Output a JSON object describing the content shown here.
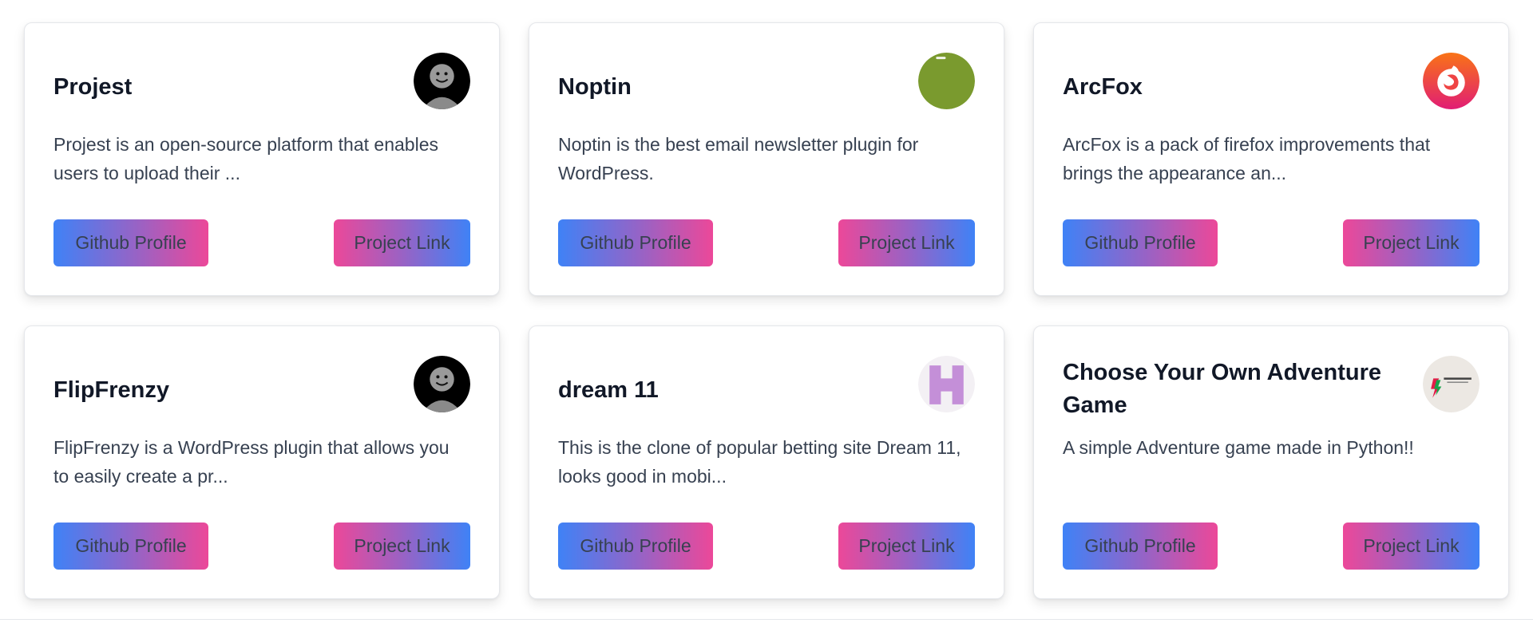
{
  "buttons": {
    "github_label": "Github Profile",
    "project_label": "Project Link"
  },
  "colors": {
    "gradient_blue": "#3f82f6",
    "gradient_pink": "#ec4899"
  },
  "projects": [
    {
      "title": "Projest",
      "description": "Projest is an open-source platform that enables users to upload their ...",
      "avatar_icon": "smiley-avatar-icon"
    },
    {
      "title": "Noptin",
      "description": "Noptin is the best email newsletter plugin for WordPress.",
      "avatar_icon": "green-circle-logo-icon"
    },
    {
      "title": "ArcFox",
      "description": "ArcFox is a pack of firefox improvements that brings the appearance an...",
      "avatar_icon": "firefox-logo-icon"
    },
    {
      "title": "FlipFrenzy",
      "description": "FlipFrenzy is a WordPress plugin that allows you to easily create a pr...",
      "avatar_icon": "smiley-avatar-icon"
    },
    {
      "title": "dream 11",
      "description": "This is the clone of popular betting site Dream 11, looks good in mobi...",
      "avatar_icon": "letter-h-logo-icon"
    },
    {
      "title": "Choose Your Own Adventure Game",
      "description": "A simple Adventure game made in Python!!",
      "avatar_icon": "coding-logo-icon"
    }
  ]
}
